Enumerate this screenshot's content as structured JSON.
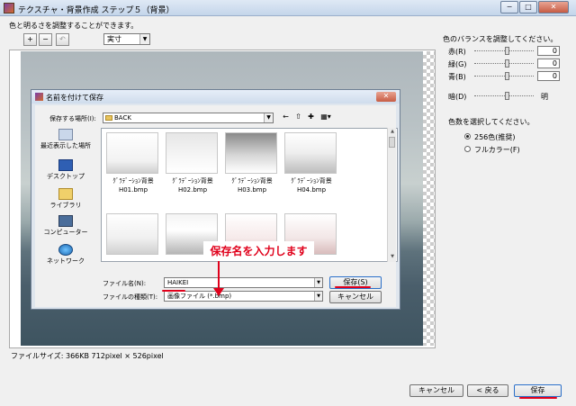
{
  "window": {
    "title": "テクスチャ・背景作成 ステップ５（背景）",
    "controls": [
      "−",
      "□",
      "✕"
    ]
  },
  "instruction": "色と明るさを調整することができます。",
  "toolbar": {
    "zoom_in": "+",
    "zoom_out": "−",
    "undo": "↶",
    "zoom_select": "実寸"
  },
  "preview": {
    "file_size": "ファイルサイズ: 366KB 712pixel × 526pixel"
  },
  "right_panel": {
    "balance_title": "色のバランスを調整してください。",
    "red_label": "赤(R)",
    "green_label": "緑(G)",
    "blue_label": "青(B)",
    "red_value": "0",
    "green_value": "0",
    "blue_value": "0",
    "dark_label": "暗(D)",
    "bright_label": "明",
    "color_count_title": "色数を選択してください。",
    "option_256": "256色(推奨)",
    "option_full": "フルカラー(F)",
    "selected_option": "256色(推奨)"
  },
  "bottom_buttons": {
    "cancel": "キャンセル",
    "back": "< 戻る",
    "save": "保存"
  },
  "save_dialog": {
    "title": "名前を付けて保存",
    "close": "✕",
    "location_label": "保存する場所(I):",
    "location_value": "BACK",
    "places": [
      "最近表示した場所",
      "デスクトップ",
      "ライブラリ",
      "コンピューター",
      "ネットワーク"
    ],
    "files": [
      {
        "line1": "ｸﾞﾗﾃﾞｰｼｮﾝ背景",
        "line2": "H01.bmp"
      },
      {
        "line1": "ｸﾞﾗﾃﾞｰｼｮﾝ背景",
        "line2": "H02.bmp"
      },
      {
        "line1": "ｸﾞﾗﾃﾞｰｼｮﾝ背景",
        "line2": "H03.bmp"
      },
      {
        "line1": "ｸﾞﾗﾃﾞｰｼｮﾝ背景",
        "line2": "H04.bmp"
      }
    ],
    "filename_label": "ファイル名(N):",
    "filename_value": "HAIKEI",
    "filetype_label": "ファイルの種類(T):",
    "filetype_value": "画像ファイル (*.bmp)",
    "save_button": "保存(S)",
    "cancel_button": "キャンセル"
  },
  "annotation": {
    "text": "保存名を入力します"
  },
  "colors": {
    "accent_red": "#e0001b",
    "titlebar": "#c4d5ea"
  }
}
